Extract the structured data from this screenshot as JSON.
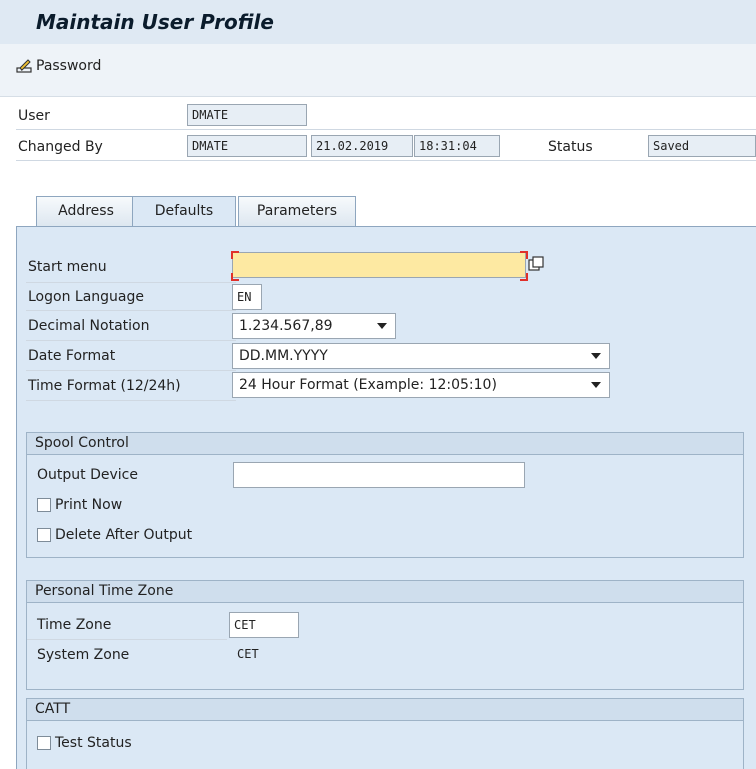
{
  "header": {
    "title": "Maintain User Profile"
  },
  "toolbar": {
    "password_label": "Password",
    "password_icon": "edit-pencil-icon"
  },
  "user_info": {
    "user_label": "User",
    "user_value": "DMATE",
    "changed_by_label": "Changed By",
    "changed_by_value": "DMATE",
    "changed_date": "21.02.2019",
    "changed_time": "18:31:04",
    "status_label": "Status",
    "status_value": "Saved"
  },
  "tabs": [
    {
      "label": "Address",
      "active": false
    },
    {
      "label": "Defaults",
      "active": true
    },
    {
      "label": "Parameters",
      "active": false
    }
  ],
  "defaults": {
    "start_menu_label": "Start menu",
    "start_menu_value": "",
    "logon_language_label": "Logon Language",
    "logon_language_value": "EN",
    "decimal_notation_label": "Decimal Notation",
    "decimal_notation_value": "1.234.567,89",
    "date_format_label": "Date Format",
    "date_format_value": "DD.MM.YYYY",
    "time_format_label": "Time Format (12/24h)",
    "time_format_value": "24 Hour Format (Example: 12:05:10)"
  },
  "spool": {
    "title": "Spool Control",
    "output_device_label": "Output Device",
    "output_device_value": "",
    "print_now_label": "Print Now",
    "print_now_checked": false,
    "delete_after_output_label": "Delete After Output",
    "delete_after_output_checked": false
  },
  "time_zone": {
    "title": "Personal Time Zone",
    "time_zone_label": "Time Zone",
    "time_zone_value": "CET",
    "system_zone_label": "System Zone",
    "system_zone_value": "CET"
  },
  "catt": {
    "title": "CATT",
    "test_status_label": "Test Status",
    "test_status_checked": false
  },
  "colors": {
    "accent": "#dbe8f5",
    "required_field": "#fde9a2",
    "required_mark": "#e0302a"
  }
}
